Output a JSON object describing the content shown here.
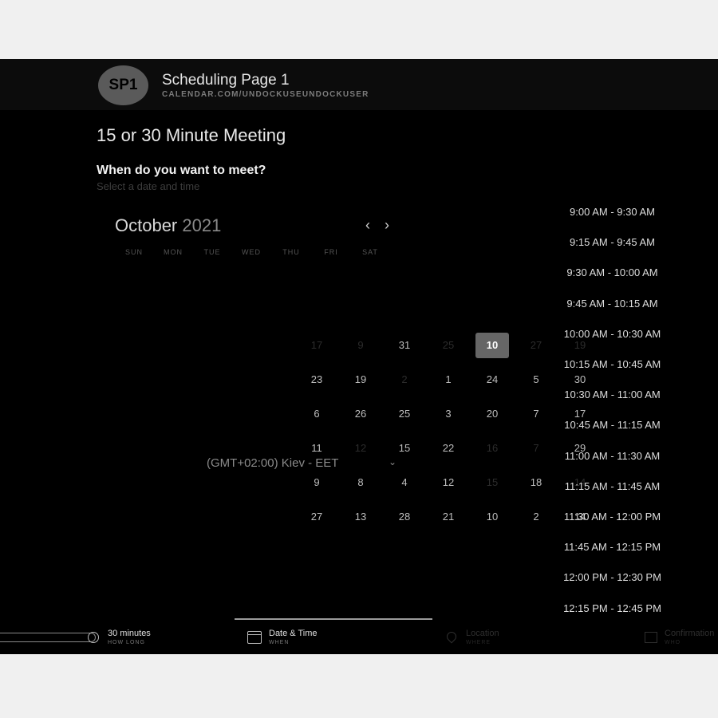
{
  "header": {
    "avatar_initials": "SP1",
    "title": "Scheduling Page 1",
    "url": "CALENDAR.COM/UNDOCKUSEUNDOCKUSER"
  },
  "meeting_title": "15 or 30 Minute Meeting",
  "question": {
    "title": "When do you want to meet?",
    "subtitle": "Select a date and time"
  },
  "calendar": {
    "month": "October",
    "year": "2021",
    "prev_icon": "chevron-left-icon",
    "next_icon": "chevron-right-icon",
    "weekdays": [
      "SUN",
      "MON",
      "TUE",
      "WED",
      "THU",
      "FRI",
      "SAT"
    ],
    "selected_day": "10",
    "rows": [
      [
        "17",
        "9",
        "31",
        "25",
        "10",
        "27",
        "19"
      ],
      [
        "23",
        "19",
        "2",
        "1",
        "24",
        "5",
        "30"
      ],
      [
        "6",
        "26",
        "25",
        "3",
        "20",
        "7",
        "17"
      ],
      [
        "11",
        "12",
        "15",
        "22",
        "16",
        "7",
        "29"
      ],
      [
        "9",
        "8",
        "4",
        "12",
        "15",
        "18",
        "14"
      ],
      [
        "27",
        "13",
        "28",
        "21",
        "10",
        "2",
        "14"
      ]
    ]
  },
  "timezone": {
    "label": "(GMT+02:00) Kiev - EET",
    "icon": "chevron-down-icon"
  },
  "time_slots": [
    "9:00 AM - 9:30 AM",
    "9:15 AM - 9:45 AM",
    "9:30 AM - 10:00 AM",
    "9:45 AM - 10:15 AM",
    "10:00 AM - 10:30 AM",
    "10:15 AM - 10:45 AM",
    "10:30 AM - 11:00 AM",
    "10:45 AM - 11:15 AM",
    "11:00 AM - 11:30 AM",
    "11:15 AM - 11:45 AM",
    "11:30 AM - 12:00 PM",
    "11:45 AM - 12:15 PM",
    "12:00 PM - 12:30 PM",
    "12:15 PM - 12:45 PM"
  ],
  "steps": [
    {
      "label": "30 minutes",
      "sub": "HOW LONG",
      "icon": "clock-icon"
    },
    {
      "label": "Date & Time",
      "sub": "WHEN",
      "icon": "calendar-icon"
    },
    {
      "label": "Location",
      "sub": "WHERE",
      "icon": "location-pin-icon"
    },
    {
      "label": "Confirmation",
      "sub": "WHO",
      "icon": "confirmation-icon"
    }
  ]
}
